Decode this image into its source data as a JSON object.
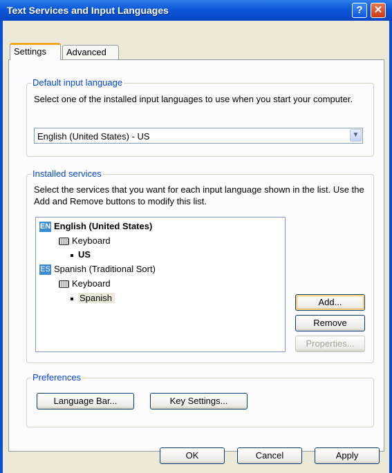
{
  "window": {
    "title": "Text Services and Input Languages"
  },
  "titlebar_buttons": {
    "help": "?",
    "close": "✕"
  },
  "tabs": [
    {
      "label": "Settings"
    },
    {
      "label": "Advanced"
    }
  ],
  "default_input": {
    "legend": "Default input language",
    "description": "Select one of the installed input languages to use when you start your computer.",
    "selected": "English (United States) - US"
  },
  "installed_services": {
    "legend": "Installed services",
    "description": "Select the services that you want for each input language shown in the list. Use the Add and Remove buttons to modify this list.",
    "languages": [
      {
        "badge": "EN",
        "name": "English (United States)",
        "service": "Keyboard",
        "layout": "US"
      },
      {
        "badge": "ES",
        "name": "Spanish (Traditional Sort)",
        "service": "Keyboard",
        "layout": "Spanish"
      }
    ],
    "buttons": {
      "add": "Add...",
      "remove": "Remove",
      "properties": "Properties..."
    }
  },
  "preferences": {
    "legend": "Preferences",
    "buttons": {
      "language_bar": "Language Bar...",
      "key_settings": "Key Settings..."
    }
  },
  "footer": {
    "ok": "OK",
    "cancel": "Cancel",
    "apply": "Apply"
  }
}
